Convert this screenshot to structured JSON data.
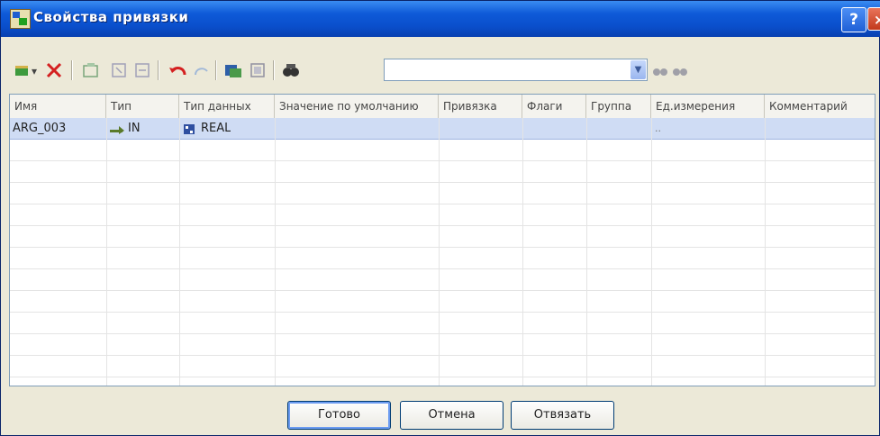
{
  "window": {
    "title": "Свойства привязки",
    "help_label": "?",
    "close_label": "×"
  },
  "toolbar": {
    "search_value": "",
    "icons": [
      "add-dropdown-icon",
      "delete-icon",
      "new-folder-icon",
      "import-icon",
      "export-icon",
      "undo-icon",
      "redo-icon",
      "copy-binding-icon",
      "paste-binding-icon",
      "find-icon",
      "combo-dropdown-icon",
      "find-next-icon",
      "find-prev-icon"
    ]
  },
  "grid": {
    "columns": [
      "Имя",
      "Тип",
      "Тип данных",
      "Значение по умолчанию",
      "Привязка",
      "Флаги",
      "Группа",
      "Ед.измерения",
      "Комментарий"
    ],
    "rows": [
      {
        "name": "ARG_003",
        "type": "IN",
        "datatype": "REAL",
        "default": "",
        "binding": "",
        "flags": "",
        "group": "",
        "unit": "..",
        "comment": ""
      }
    ]
  },
  "buttons": {
    "ok": "Готово",
    "cancel": "Отмена",
    "unbind": "Отвязать"
  },
  "colors": {
    "title_bar": "#0a4fcc",
    "selected_row": "#cfdcf4",
    "dialog_bg": "#ece9d8"
  }
}
